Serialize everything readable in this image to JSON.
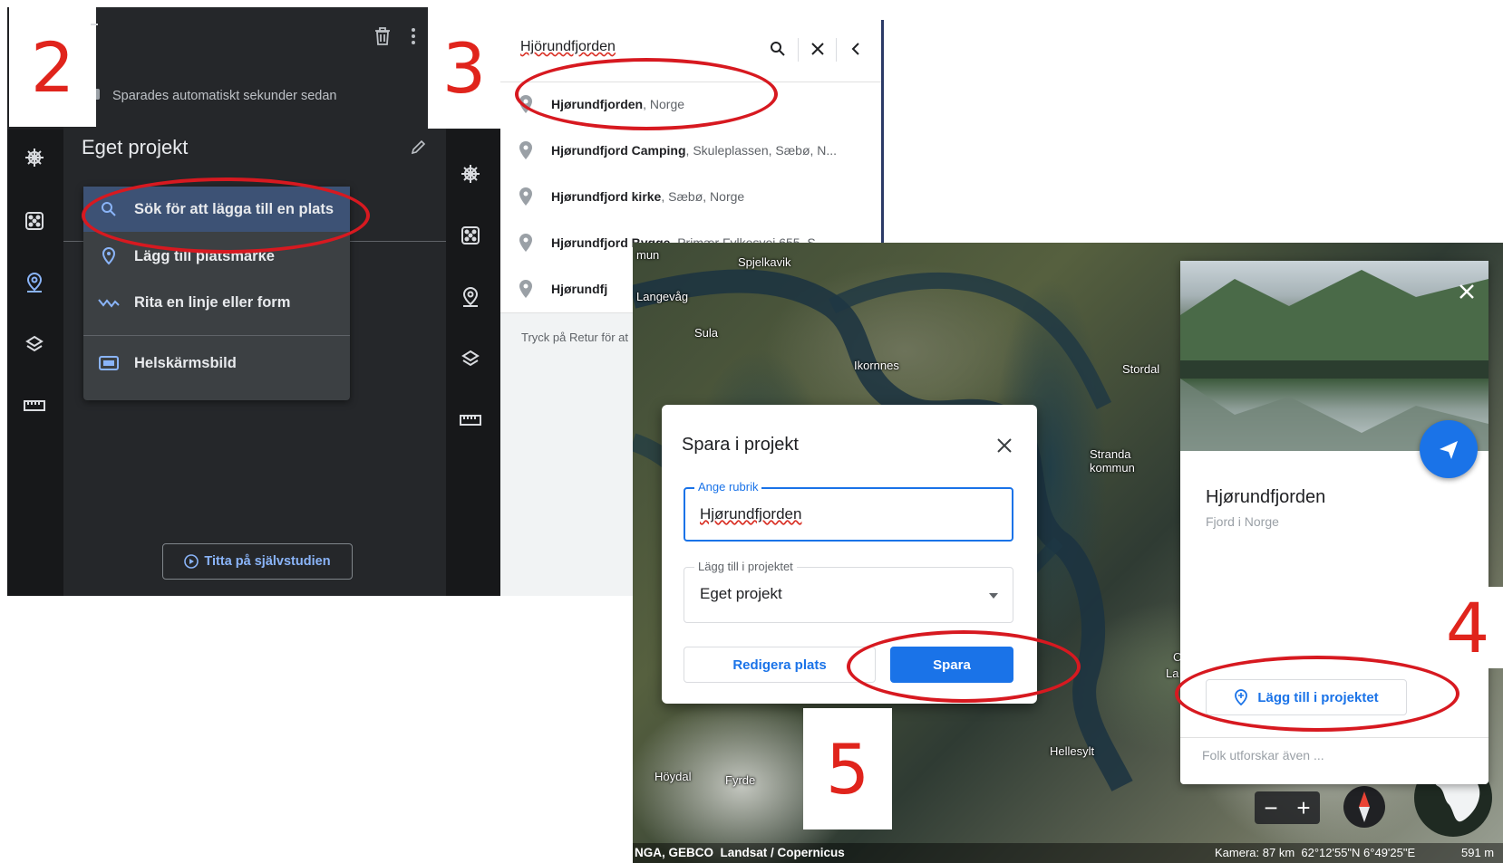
{
  "step_badges": {
    "two": "2",
    "three": "3",
    "four": "4",
    "five": "5"
  },
  "panel2": {
    "autosave_text": "Sparades automatiskt sekunder sedan",
    "project_title": "Eget projekt",
    "menu": {
      "search": "Sök för att lägga till en plats",
      "placemark": "Lägg till platsmärke",
      "draw": "Rita en linje eller form",
      "fullscreen": "Helskärmsbild"
    },
    "tutorial_button": "Titta på självstudien"
  },
  "panel3": {
    "search_value": "Hjörundfjorden",
    "results": [
      {
        "name": "Hjørundfjorden",
        "detail": ", Norge"
      },
      {
        "name": "Hjørundfjord Camping",
        "detail": ", Skuleplassen, Sæbø, N..."
      },
      {
        "name": "Hjørundfjord kirke",
        "detail": ", Sæbø, Norge"
      },
      {
        "name": "Hjørundfjord Bygge",
        "detail": ", Primær Fylkesvei 655, S..."
      },
      {
        "name": "Hjørundfj",
        "detail": ""
      }
    ],
    "hint": "Tryck på Retur för at"
  },
  "map": {
    "labels": {
      "spjelkavik": "Spjelkavik",
      "kommun_top": "mun",
      "langevag": "Langevåg",
      "sula": "Sula",
      "ikornnes": "Ikornnes",
      "stordal": "Stordal",
      "stranda": "Stranda",
      "stranda_kommun": "kommun",
      "hellesylt": "Hellesylt",
      "hoydal": "Höydal",
      "fyrde": "Fyrde",
      "la": "La",
      "c": "C"
    },
    "attribution": "NGA, GEBCO  Landsat / Copernicus",
    "camera": "Kamera: 87 km  62°12'55\"N 6°49'25\"E",
    "scale": "591 m"
  },
  "dialog": {
    "title": "Spara i projekt",
    "name_label": "Ange rubrik",
    "name_value": "Hjørundfjorden",
    "project_label": "Lägg till i projektet",
    "project_value": "Eget projekt",
    "edit_button": "Redigera plats",
    "save_button": "Spara"
  },
  "card": {
    "title": "Hjørundfjorden",
    "subtitle": "Fjord i Norge",
    "add_button": "Lägg till i projektet",
    "explore_text": "Folk utforskar även ..."
  },
  "colors": {
    "accent": "#1a73e8",
    "annotation": "#d71920",
    "dark_bg": "#202124"
  }
}
